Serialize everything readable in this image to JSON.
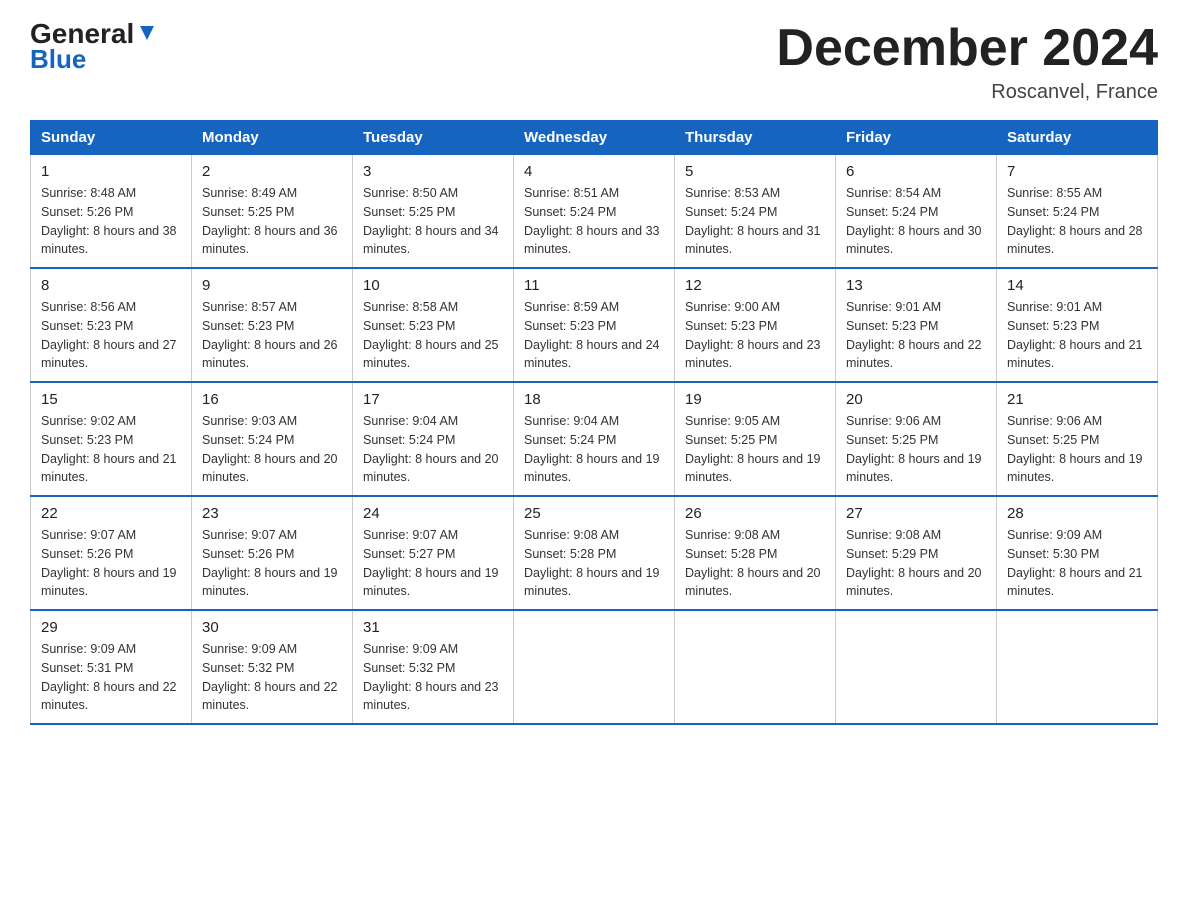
{
  "logo": {
    "general": "General",
    "blue": "Blue",
    "arrow_char": "▼"
  },
  "title": "December 2024",
  "location": "Roscanvel, France",
  "days_of_week": [
    "Sunday",
    "Monday",
    "Tuesday",
    "Wednesday",
    "Thursday",
    "Friday",
    "Saturday"
  ],
  "weeks": [
    [
      {
        "day": "1",
        "sunrise": "8:48 AM",
        "sunset": "5:26 PM",
        "daylight": "8 hours and 38 minutes."
      },
      {
        "day": "2",
        "sunrise": "8:49 AM",
        "sunset": "5:25 PM",
        "daylight": "8 hours and 36 minutes."
      },
      {
        "day": "3",
        "sunrise": "8:50 AM",
        "sunset": "5:25 PM",
        "daylight": "8 hours and 34 minutes."
      },
      {
        "day": "4",
        "sunrise": "8:51 AM",
        "sunset": "5:24 PM",
        "daylight": "8 hours and 33 minutes."
      },
      {
        "day": "5",
        "sunrise": "8:53 AM",
        "sunset": "5:24 PM",
        "daylight": "8 hours and 31 minutes."
      },
      {
        "day": "6",
        "sunrise": "8:54 AM",
        "sunset": "5:24 PM",
        "daylight": "8 hours and 30 minutes."
      },
      {
        "day": "7",
        "sunrise": "8:55 AM",
        "sunset": "5:24 PM",
        "daylight": "8 hours and 28 minutes."
      }
    ],
    [
      {
        "day": "8",
        "sunrise": "8:56 AM",
        "sunset": "5:23 PM",
        "daylight": "8 hours and 27 minutes."
      },
      {
        "day": "9",
        "sunrise": "8:57 AM",
        "sunset": "5:23 PM",
        "daylight": "8 hours and 26 minutes."
      },
      {
        "day": "10",
        "sunrise": "8:58 AM",
        "sunset": "5:23 PM",
        "daylight": "8 hours and 25 minutes."
      },
      {
        "day": "11",
        "sunrise": "8:59 AM",
        "sunset": "5:23 PM",
        "daylight": "8 hours and 24 minutes."
      },
      {
        "day": "12",
        "sunrise": "9:00 AM",
        "sunset": "5:23 PM",
        "daylight": "8 hours and 23 minutes."
      },
      {
        "day": "13",
        "sunrise": "9:01 AM",
        "sunset": "5:23 PM",
        "daylight": "8 hours and 22 minutes."
      },
      {
        "day": "14",
        "sunrise": "9:01 AM",
        "sunset": "5:23 PM",
        "daylight": "8 hours and 21 minutes."
      }
    ],
    [
      {
        "day": "15",
        "sunrise": "9:02 AM",
        "sunset": "5:23 PM",
        "daylight": "8 hours and 21 minutes."
      },
      {
        "day": "16",
        "sunrise": "9:03 AM",
        "sunset": "5:24 PM",
        "daylight": "8 hours and 20 minutes."
      },
      {
        "day": "17",
        "sunrise": "9:04 AM",
        "sunset": "5:24 PM",
        "daylight": "8 hours and 20 minutes."
      },
      {
        "day": "18",
        "sunrise": "9:04 AM",
        "sunset": "5:24 PM",
        "daylight": "8 hours and 19 minutes."
      },
      {
        "day": "19",
        "sunrise": "9:05 AM",
        "sunset": "5:25 PM",
        "daylight": "8 hours and 19 minutes."
      },
      {
        "day": "20",
        "sunrise": "9:06 AM",
        "sunset": "5:25 PM",
        "daylight": "8 hours and 19 minutes."
      },
      {
        "day": "21",
        "sunrise": "9:06 AM",
        "sunset": "5:25 PM",
        "daylight": "8 hours and 19 minutes."
      }
    ],
    [
      {
        "day": "22",
        "sunrise": "9:07 AM",
        "sunset": "5:26 PM",
        "daylight": "8 hours and 19 minutes."
      },
      {
        "day": "23",
        "sunrise": "9:07 AM",
        "sunset": "5:26 PM",
        "daylight": "8 hours and 19 minutes."
      },
      {
        "day": "24",
        "sunrise": "9:07 AM",
        "sunset": "5:27 PM",
        "daylight": "8 hours and 19 minutes."
      },
      {
        "day": "25",
        "sunrise": "9:08 AM",
        "sunset": "5:28 PM",
        "daylight": "8 hours and 19 minutes."
      },
      {
        "day": "26",
        "sunrise": "9:08 AM",
        "sunset": "5:28 PM",
        "daylight": "8 hours and 20 minutes."
      },
      {
        "day": "27",
        "sunrise": "9:08 AM",
        "sunset": "5:29 PM",
        "daylight": "8 hours and 20 minutes."
      },
      {
        "day": "28",
        "sunrise": "9:09 AM",
        "sunset": "5:30 PM",
        "daylight": "8 hours and 21 minutes."
      }
    ],
    [
      {
        "day": "29",
        "sunrise": "9:09 AM",
        "sunset": "5:31 PM",
        "daylight": "8 hours and 22 minutes."
      },
      {
        "day": "30",
        "sunrise": "9:09 AM",
        "sunset": "5:32 PM",
        "daylight": "8 hours and 22 minutes."
      },
      {
        "day": "31",
        "sunrise": "9:09 AM",
        "sunset": "5:32 PM",
        "daylight": "8 hours and 23 minutes."
      },
      null,
      null,
      null,
      null
    ]
  ]
}
